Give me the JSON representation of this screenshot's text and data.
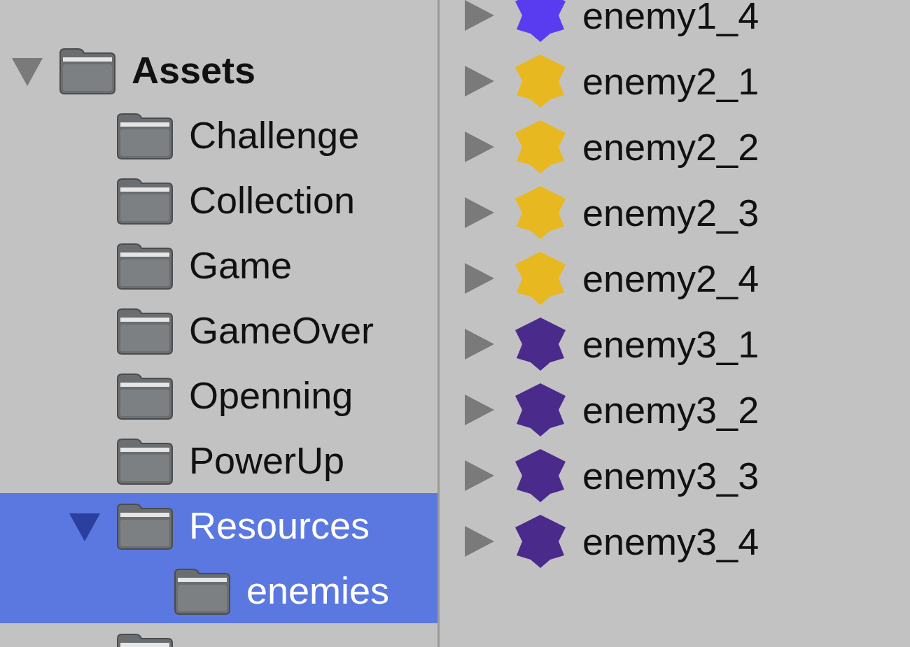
{
  "folder_tree": {
    "label": "Assets",
    "expanded": true,
    "selected": false,
    "children": [
      {
        "label": "Challenge",
        "selected": false
      },
      {
        "label": "Collection",
        "selected": false
      },
      {
        "label": "Game",
        "selected": false
      },
      {
        "label": "GameOver",
        "selected": false
      },
      {
        "label": "Openning",
        "selected": false
      },
      {
        "label": "PowerUp",
        "selected": false
      },
      {
        "label": "Resources",
        "expanded": true,
        "selected": true,
        "children": [
          {
            "label": "enemies",
            "selected": true
          }
        ]
      },
      {
        "selected": false
      }
    ]
  },
  "assets": [
    {
      "label": "enemy1_4",
      "expanded": false,
      "color": "#5a3cf0"
    },
    {
      "label": "enemy2_1",
      "expanded": false,
      "color": "#e8b820"
    },
    {
      "label": "enemy2_2",
      "expanded": false,
      "color": "#e8b820"
    },
    {
      "label": "enemy2_3",
      "expanded": false,
      "color": "#e8b820"
    },
    {
      "label": "enemy2_4",
      "expanded": false,
      "color": "#e8b820"
    },
    {
      "label": "enemy3_1",
      "expanded": false,
      "color": "#4a2a8a"
    },
    {
      "label": "enemy3_2",
      "expanded": false,
      "color": "#4a2a8a"
    },
    {
      "label": "enemy3_3",
      "expanded": false,
      "color": "#4a2a8a"
    },
    {
      "label": "enemy3_4",
      "expanded": false,
      "color": "#4a2a8a"
    }
  ]
}
